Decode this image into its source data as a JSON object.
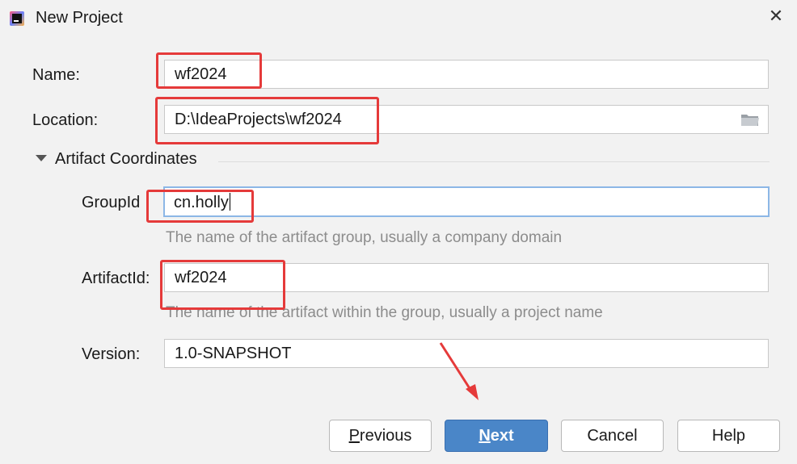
{
  "window": {
    "title": "New Project",
    "close_glyph": "✕"
  },
  "form": {
    "name": {
      "label": "Name:",
      "value": "wf2024"
    },
    "location": {
      "label": "Location:",
      "value": "D:\\IdeaProjects\\wf2024"
    },
    "artifact_section": {
      "label": "Artifact Coordinates",
      "expanded": true
    },
    "group_id": {
      "label": "GroupId",
      "value": "cn.holly",
      "hint": "The name of the artifact group, usually a company domain"
    },
    "artifact_id": {
      "label": "ArtifactId:",
      "value": "wf2024",
      "hint": "The name of the artifact within the group, usually a project name"
    },
    "version": {
      "label": "Version:",
      "value": "1.0-SNAPSHOT"
    }
  },
  "buttons": {
    "previous": {
      "mnemonic": "P",
      "rest": "revious"
    },
    "next": {
      "mnemonic": "N",
      "rest": "ext"
    },
    "cancel": {
      "label": "Cancel"
    },
    "help": {
      "label": "Help"
    }
  },
  "annotations": {
    "highlight_color": "#e53a3a"
  },
  "icons": {
    "app": "intellij-idea-icon",
    "folder": "folder-icon",
    "close": "close-icon"
  }
}
